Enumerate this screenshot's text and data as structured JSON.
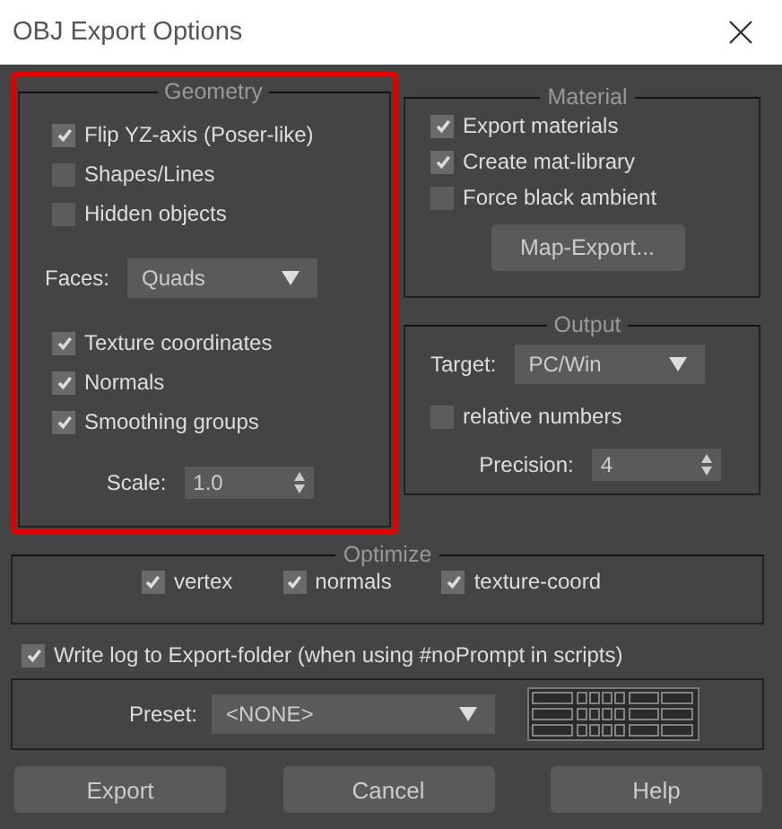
{
  "window": {
    "title": "OBJ Export Options"
  },
  "geometry": {
    "title": "Geometry",
    "highlighted": true,
    "items": [
      {
        "kind": "checkbox",
        "label": "Flip YZ-axis (Poser-like)",
        "checked": true
      },
      {
        "kind": "checkbox",
        "label": "Shapes/Lines",
        "checked": false
      },
      {
        "kind": "checkbox",
        "label": "Hidden objects",
        "checked": false
      },
      {
        "kind": "dropdown",
        "label": "Faces:",
        "value": "Quads"
      },
      {
        "kind": "checkbox",
        "label": "Texture coordinates",
        "checked": true
      },
      {
        "kind": "checkbox",
        "label": "Normals",
        "checked": true
      },
      {
        "kind": "checkbox",
        "label": "Smoothing groups",
        "checked": true
      },
      {
        "kind": "spinner",
        "label": "Scale:",
        "value": "1.0"
      }
    ]
  },
  "material": {
    "title": "Material",
    "items": [
      {
        "kind": "checkbox",
        "label": "Export materials",
        "checked": true
      },
      {
        "kind": "checkbox",
        "label": "Create mat-library",
        "checked": true
      },
      {
        "kind": "checkbox",
        "label": "Force black ambient",
        "checked": false
      },
      {
        "kind": "button",
        "label": "Map-Export..."
      }
    ]
  },
  "output": {
    "title": "Output",
    "items": [
      {
        "kind": "dropdown",
        "label": "Target:",
        "value": "PC/Win"
      },
      {
        "kind": "checkbox",
        "label": "relative numbers",
        "checked": false
      },
      {
        "kind": "spinner",
        "label": "Precision:",
        "value": "4"
      }
    ]
  },
  "optimize": {
    "title": "Optimize",
    "items": [
      {
        "label": "vertex",
        "checked": true
      },
      {
        "label": "normals",
        "checked": true
      },
      {
        "label": "texture-coord",
        "checked": true
      }
    ]
  },
  "write_log": {
    "label": "Write log to Export-folder (when using #noPrompt in scripts)",
    "checked": true
  },
  "preset": {
    "label": "Preset:",
    "value": "<NONE>"
  },
  "buttons": [
    "Export",
    "Cancel",
    "Help"
  ]
}
